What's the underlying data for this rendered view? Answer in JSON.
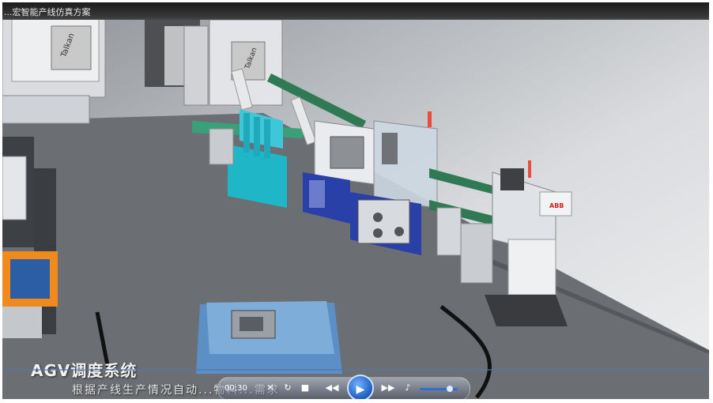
{
  "window": {
    "title": "...宏智能产线仿真方案"
  },
  "overlay": {
    "heading": "AGV调度系统",
    "caption": "根据产线生产情况自动...物料...需求"
  },
  "scene": {
    "brand_labels": [
      "Talkan",
      "Talkan"
    ],
    "robot_logo": "ABB"
  },
  "player": {
    "time": "00:30",
    "icons": {
      "close": "close-icon",
      "repeat": "repeat-icon",
      "stop": "stop-icon",
      "previous": "previous-icon",
      "play": "play-icon",
      "next": "next-icon",
      "volume": "volume-icon"
    },
    "volume_level": 0.85
  },
  "colors": {
    "floor": "#6b6e72",
    "accent_cyan": "#1fb6c8",
    "accent_blue": "#2940a8",
    "player_blue": "#2a6fd8"
  }
}
